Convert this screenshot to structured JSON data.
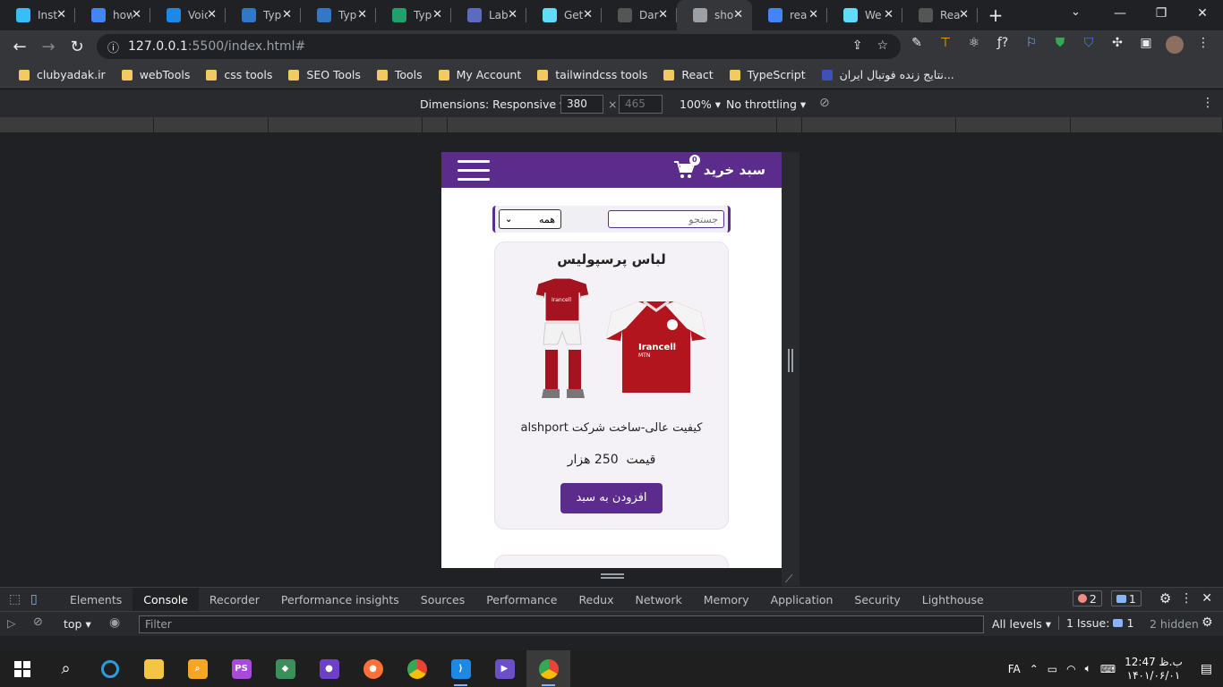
{
  "browser": {
    "tabs": [
      {
        "title": "Inst",
        "icon": "tailwind-icon",
        "color": "#38bdf8"
      },
      {
        "title": "how",
        "icon": "google-icon",
        "color": "#4285f4"
      },
      {
        "title": "Voic",
        "icon": "typeform-icon",
        "color": "#1e88e5"
      },
      {
        "title": "Typ",
        "icon": "typescript-icon",
        "color": "#3178c6"
      },
      {
        "title": "Typ",
        "icon": "typescript-icon",
        "color": "#3178c6"
      },
      {
        "title": "Typ",
        "icon": "w-icon",
        "color": "#22a06b"
      },
      {
        "title": "Lab",
        "icon": "lab-icon",
        "color": "#5c6bc0"
      },
      {
        "title": "Get",
        "icon": "react-icon",
        "color": "#61dafb"
      },
      {
        "title": "Dar",
        "icon": "github-icon",
        "color": "#555"
      },
      {
        "title": "sho",
        "icon": "globe-icon",
        "color": "#9aa0a6"
      },
      {
        "title": "rea",
        "icon": "google-icon",
        "color": "#4285f4"
      },
      {
        "title": "We",
        "icon": "react-icon",
        "color": "#61dafb"
      },
      {
        "title": "Rea",
        "icon": "github-icon",
        "color": "#555"
      }
    ],
    "active_tab_index": 9,
    "url_host": "127.0.0.1",
    "url_rest": ":5500/index.html#",
    "bookmarks": [
      "clubyadak.ir",
      "webTools",
      "css tools",
      "SEO Tools",
      "Tools",
      "My Account",
      "tailwindcss tools",
      "React",
      "TypeScript",
      "نتایج زنده فوتبال ایران..."
    ]
  },
  "device_toolbar": {
    "dimensions_label": "Dimensions: Responsive",
    "width": "380",
    "height": "465",
    "zoom": "100%",
    "throttling": "No throttling"
  },
  "page": {
    "header": {
      "cart_label": "سبد خرید",
      "cart_count": "0"
    },
    "search": {
      "placeholder": "جستجو"
    },
    "category_select": {
      "selected": "همه"
    },
    "product": {
      "title": "لباس پرسپولیس",
      "description": "کیفیت عالی-ساخت شرکت alshport",
      "price_label": "قیمت",
      "price_value": "250",
      "price_unit": "هزار",
      "button_label": "افزودن به سبد",
      "kit_text": "Irancell",
      "kit_subtext": "MTN"
    }
  },
  "devtools": {
    "tabs": [
      "Elements",
      "Console",
      "Recorder",
      "Performance insights",
      "Sources",
      "Performance",
      "Redux",
      "Network",
      "Memory",
      "Application",
      "Security",
      "Lighthouse"
    ],
    "active_tab": "Console",
    "error_count": "2",
    "message_count": "1",
    "context": "top",
    "filter_placeholder": "Filter",
    "levels": "All levels",
    "issues": "1 Issue:",
    "issues_count": "1",
    "hidden": "2 hidden"
  },
  "taskbar": {
    "language": "FA",
    "time": "12:47 ب.ظ",
    "date": "۱۴۰۱/۰۶/۰۱"
  }
}
